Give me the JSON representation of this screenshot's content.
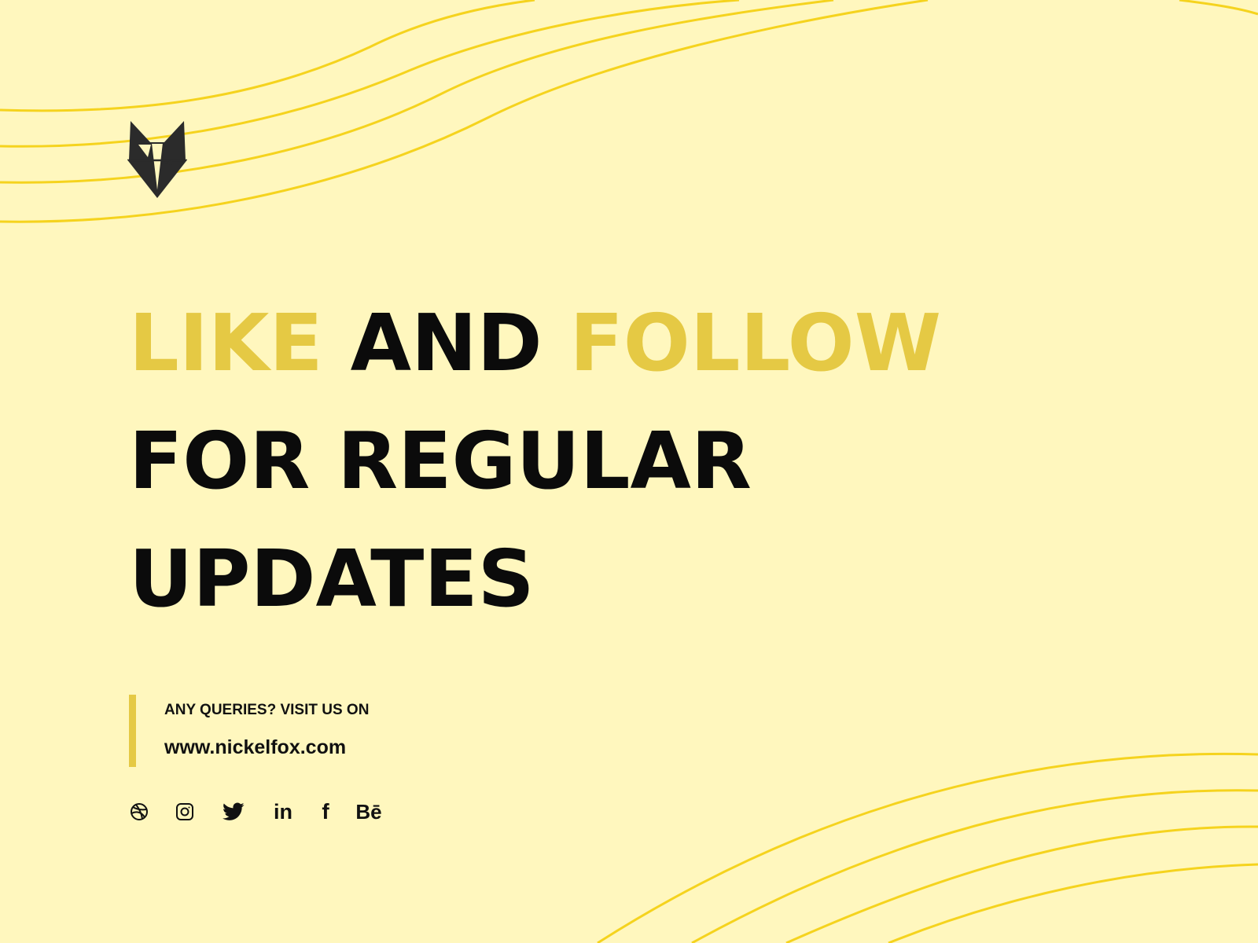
{
  "colors": {
    "background": "#FFF7BE",
    "accent": "#E5C944",
    "wave": "#F5D31E",
    "text": "#0B0B0B"
  },
  "logo": {
    "icon": "fox-head-logo"
  },
  "headline": {
    "line1": [
      {
        "text": "LIKE",
        "accent": true
      },
      {
        "text": "AND",
        "accent": false
      },
      {
        "text": "FOLLOW",
        "accent": true
      }
    ],
    "line2": "FOR REGULAR",
    "line3": "UPDATES"
  },
  "contact": {
    "label": "ANY QUERIES? VISIT US ON",
    "url": "www.nickelfox.com"
  },
  "social": [
    {
      "icon": "dribbble-icon"
    },
    {
      "icon": "instagram-icon"
    },
    {
      "icon": "twitter-icon"
    },
    {
      "icon": "linkedin-icon",
      "text": "in"
    },
    {
      "icon": "facebook-icon",
      "text": "f"
    },
    {
      "icon": "behance-icon",
      "text": "Bē"
    }
  ]
}
